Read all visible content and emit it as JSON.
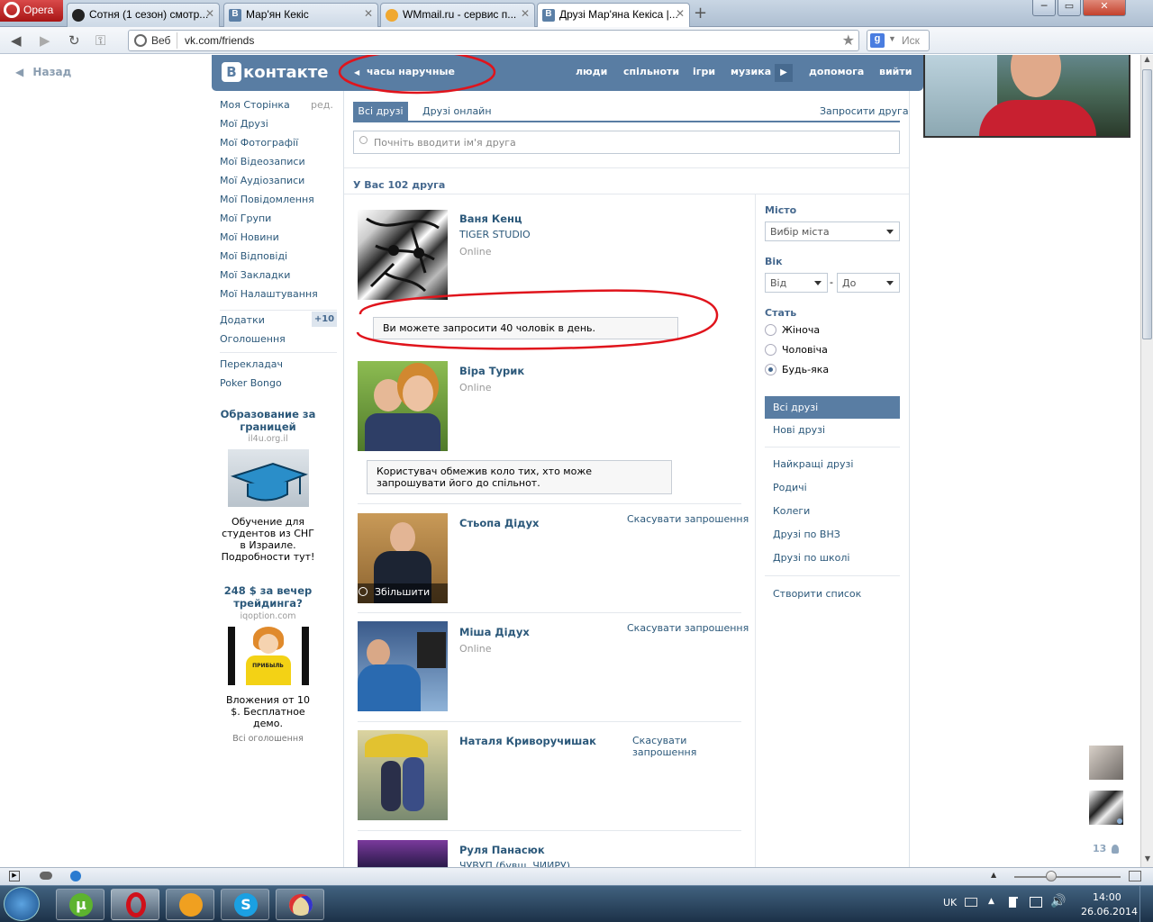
{
  "browser": {
    "menu_label": "Opera",
    "tabs": [
      {
        "title": "Сотня (1 сезон) смотр..."
      },
      {
        "title": "Мар'ян Кекіс"
      },
      {
        "title": "WMmail.ru - сервис п..."
      },
      {
        "title": "Друзі Мар'яна Кекіса |..."
      }
    ],
    "web_label": "Веб",
    "url": "vk.com/friends",
    "search_placeholder": "Иск"
  },
  "page": {
    "back_label": "Назад",
    "logo_text": "контакте",
    "header_search": "часы наручные",
    "top_nav": [
      "люди",
      "спільноти",
      "ігри",
      "музика",
      "допомога",
      "вийти"
    ],
    "left_menu": [
      "Моя Сторінка",
      "Мої Друзі",
      "Мої Фотографії",
      "Мої Відеозаписи",
      "Мої Аудіозаписи",
      "Мої Повідомлення",
      "Мої Групи",
      "Мої Новини",
      "Мої Відповіді",
      "Мої Закладки",
      "Мої Налаштування"
    ],
    "edit_label": "ред.",
    "apps_label": "Додатки",
    "apps_badge": "+10",
    "ads_label": "Оголошення",
    "translator_label": "Перекладач",
    "poker_label": "Poker Bongo",
    "ad1": {
      "title": "Образование за границей",
      "domain": "il4u.org.il",
      "text": "Обучение для студентов из СНГ в Израиле. Подробности тут!"
    },
    "ad2": {
      "title": "248 $ за вечер трейдинга?",
      "domain": "iqoption.com",
      "text": "Вложения от 10 $. Бесплатное демо.",
      "shirt_text": "ПРИБЫЛЬ"
    },
    "all_ads": "Всі оголошення",
    "tabs": {
      "all": "Всі друзі",
      "online": "Друзі онлайн",
      "invite": "Запросити друга"
    },
    "search_placeholder": "Почніть вводити ім'я друга",
    "friends_count": "У Вас 102 друга",
    "friends": [
      {
        "name": "Ваня Кенц",
        "sub": "TIGER STUDIO",
        "status": "Online",
        "action": "",
        "note": "Ви можете запросити 40 чоловік в день."
      },
      {
        "name": "Віра Турик",
        "sub": "",
        "status": "Online",
        "action": "",
        "note": "Користувач обмежив коло тих, хто може запрошувати його до спільнот."
      },
      {
        "name": "Стьопа Дідух",
        "sub": "",
        "status": "",
        "action": "Скасувати запрошення",
        "zoom": "Збільшити"
      },
      {
        "name": "Міша Дідух",
        "sub": "",
        "status": "Online",
        "action": "Скасувати запрошення"
      },
      {
        "name": "Наталя Криворучишак",
        "sub": "",
        "status": "",
        "action": "Скасувати запрошення"
      },
      {
        "name": "Руля Панасюк",
        "sub": "ЧУВУП (бувш. ЧИИРУ)",
        "status": "",
        "action": ""
      }
    ],
    "filters": {
      "city_label": "Місто",
      "city_placeholder": "Вибір міста",
      "age_label": "Вік",
      "age_from": "Від",
      "age_dash": "-",
      "age_to": "До",
      "sex_label": "Стать",
      "sex_options": [
        "Жіноча",
        "Чоловіча",
        "Будь-яка"
      ],
      "sex_selected": 2
    },
    "lists": {
      "active": "Всі друзі",
      "new": "Нові друзі",
      "groups": [
        "Найкращі друзі",
        "Родичі",
        "Колеги",
        "Друзі по ВНЗ",
        "Друзі по школі"
      ],
      "create": "Створити список"
    },
    "online_count": "13"
  },
  "taskbar": {
    "lang": "UK",
    "time": "14:00",
    "date": "26.06.2014"
  },
  "colors": {
    "vk_blue": "#597da3",
    "link": "#2b587a",
    "annotation_red": "#e0141c"
  }
}
